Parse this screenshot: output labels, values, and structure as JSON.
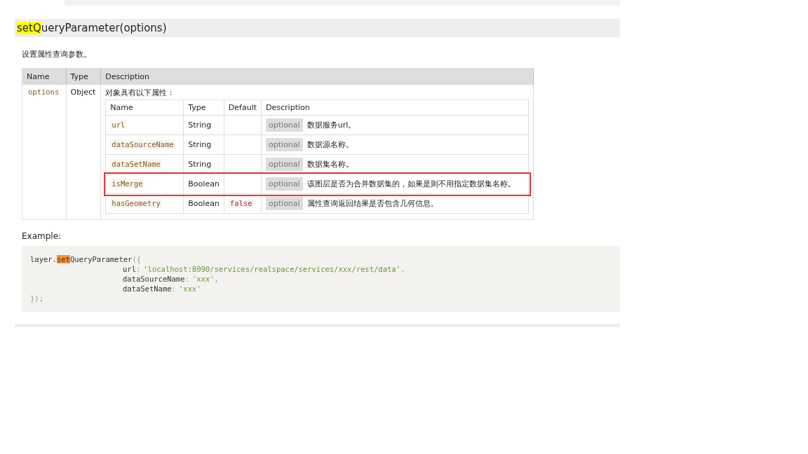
{
  "heading": {
    "highlight": "setQ",
    "rest": "ueryParameter(options)"
  },
  "summary": "设置属性查询参数。",
  "params": {
    "columns": [
      "Name",
      "Type",
      "Description"
    ],
    "rows": [
      {
        "name": "options",
        "type": "Object",
        "description": "对象具有以下属性：",
        "properties": {
          "columns": [
            "Name",
            "Type",
            "Default",
            "Description"
          ],
          "rows": [
            {
              "name": "url",
              "type": "String",
              "tag": "optional",
              "description": "数据服务url。",
              "highlighted": false
            },
            {
              "name": "dataSourceName",
              "type": "String",
              "tag": "optional",
              "description": "数据源名称。",
              "highlighted": false
            },
            {
              "name": "dataSetName",
              "type": "String",
              "tag": "optional",
              "description": "数据集名称。",
              "highlighted": false
            },
            {
              "name": "isMerge",
              "type": "Boolean",
              "tag": "optional",
              "description": "该图层是否为合并数据集的，如果是则不用指定数据集名称。",
              "highlighted": true
            },
            {
              "name": "hasGeometry",
              "type": "Boolean",
              "default": "false",
              "tag": "optional",
              "description": "属性查询返回结果是否包含几何信息。",
              "highlighted": false
            }
          ]
        }
      }
    ]
  },
  "example_label": "Example:",
  "code": [
    {
      "indented": false,
      "tokens": [
        {
          "kind": "plain",
          "text": "layer."
        },
        {
          "kind": "mark",
          "text": "set"
        },
        {
          "kind": "plain",
          "text": "QueryParameter"
        },
        {
          "kind": "punct",
          "text": "({"
        }
      ]
    },
    {
      "indented": true,
      "tokens": [
        {
          "kind": "plain",
          "text": "url"
        },
        {
          "kind": "punct",
          "text": ":"
        },
        {
          "kind": "string",
          "text": "'localhost:8090/services/realspace/services/xxx/rest/data'"
        },
        {
          "kind": "punct",
          "text": ","
        }
      ]
    },
    {
      "indented": true,
      "tokens": [
        {
          "kind": "plain",
          "text": "dataSourceName"
        },
        {
          "kind": "punct",
          "text": ":"
        },
        {
          "kind": "string",
          "text": "'xxx'"
        },
        {
          "kind": "punct",
          "text": ","
        }
      ]
    },
    {
      "indented": true,
      "tokens": [
        {
          "kind": "plain",
          "text": "dataSetName"
        },
        {
          "kind": "punct",
          "text": ":"
        },
        {
          "kind": "string",
          "text": "'xxx'"
        }
      ]
    },
    {
      "indented": false,
      "tokens": [
        {
          "kind": "punct",
          "text": "});"
        }
      ]
    }
  ]
}
